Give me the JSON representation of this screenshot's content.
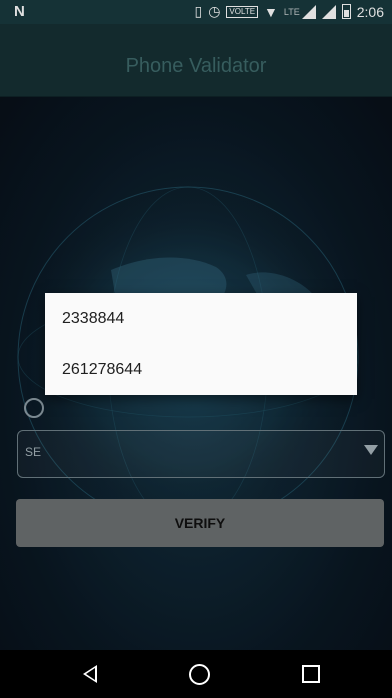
{
  "status_bar": {
    "carrier_icon": "N",
    "time": "2:06",
    "volte": "VOLTE",
    "network": "LTE",
    "icons": [
      "vibrate-icon",
      "alarm-icon",
      "volte-icon",
      "wifi-icon",
      "lte-signal-icon",
      "signal-icon",
      "battery-icon"
    ]
  },
  "app_bar": {
    "title": "Phone Validator"
  },
  "form": {
    "select_text": "SE"
  },
  "verify_button": {
    "label": "VERIFY"
  },
  "dialog": {
    "items": [
      {
        "label": "2338844"
      },
      {
        "label": "261278644"
      }
    ]
  },
  "nav_bar": {
    "icons": [
      "back-icon",
      "home-icon",
      "recent-apps-icon"
    ]
  }
}
